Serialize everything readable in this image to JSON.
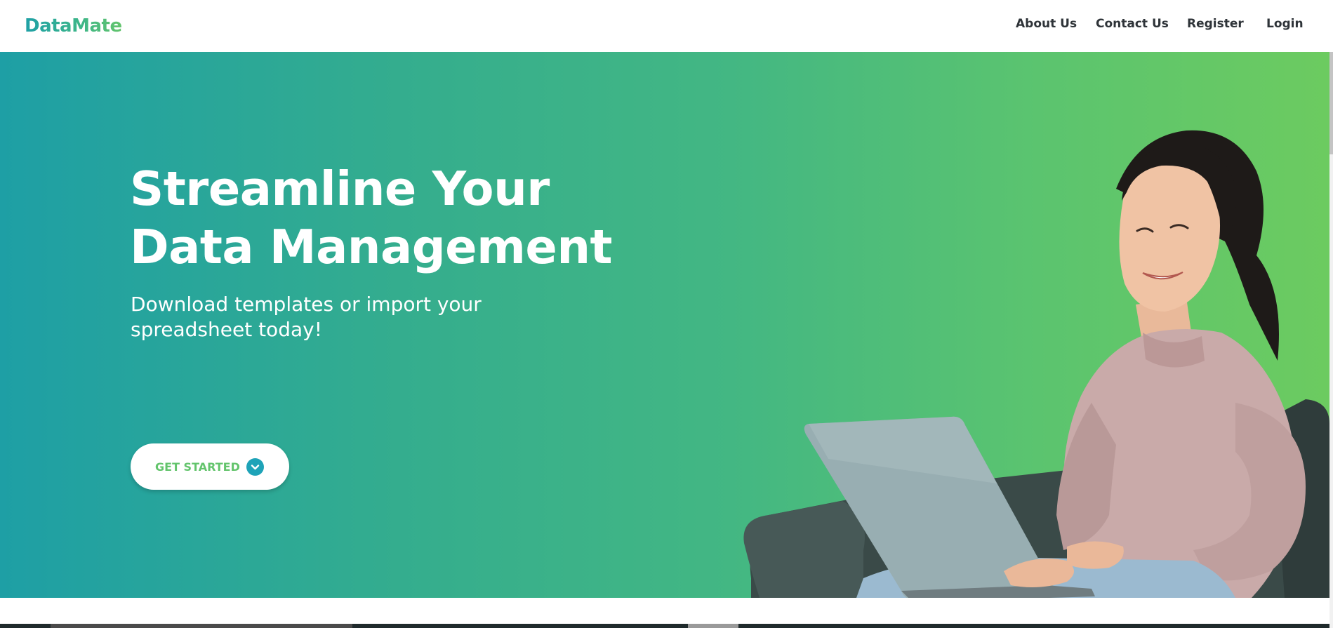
{
  "brand": {
    "logo_text": "DataMate",
    "gradient_colors": [
      "#1fa0a6",
      "#63c46c"
    ]
  },
  "nav": {
    "items": [
      {
        "label": "About Us"
      },
      {
        "label": "Contact Us"
      },
      {
        "label": "Register"
      },
      {
        "label": "Login"
      }
    ]
  },
  "hero": {
    "title_line1": "Streamline Your",
    "title_line2": "Data Management",
    "subtitle_line1": "Download templates or import your",
    "subtitle_line2": "spreadsheet today!",
    "cta_label": "GET STARTED",
    "cta_icon": "chevron-down-icon",
    "image": "woman-with-laptop-photo",
    "background_colors": [
      "#1e9fa5",
      "#6ccb60"
    ]
  }
}
